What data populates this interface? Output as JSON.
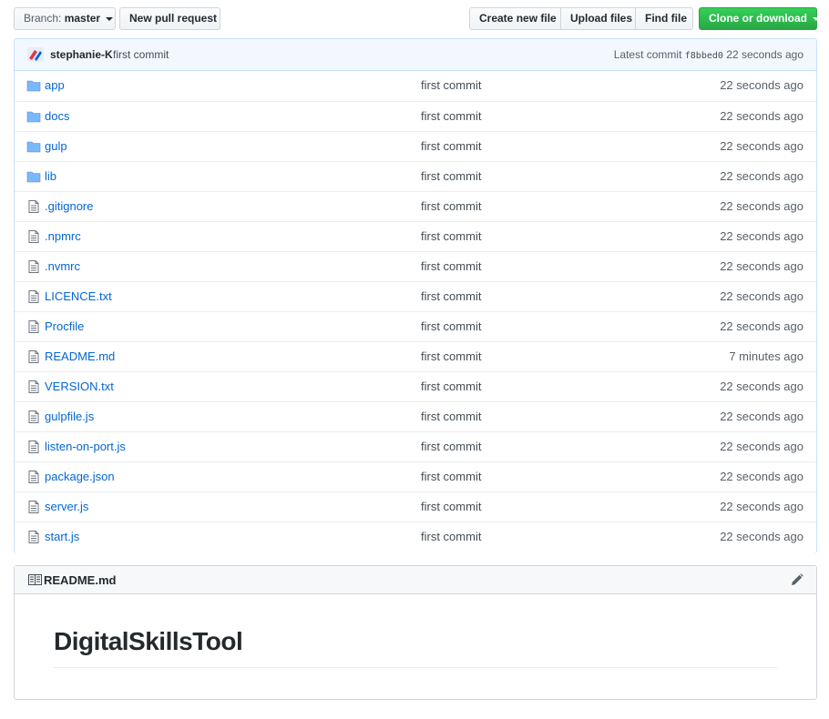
{
  "toolbar": {
    "branch_prefix": "Branch:",
    "branch_name": "master",
    "new_pull_request": "New pull request",
    "create_new_file": "Create new file",
    "upload_files": "Upload files",
    "find_file": "Find file",
    "clone_or_download": "Clone or download"
  },
  "commit": {
    "author": "stephanie-K",
    "message": "first commit",
    "latest_label": "Latest commit",
    "sha": "f8bbed0",
    "age": "22 seconds ago"
  },
  "files": [
    {
      "type": "dir",
      "name": "app",
      "message": "first commit",
      "age": "22 seconds ago"
    },
    {
      "type": "dir",
      "name": "docs",
      "message": "first commit",
      "age": "22 seconds ago"
    },
    {
      "type": "dir",
      "name": "gulp",
      "message": "first commit",
      "age": "22 seconds ago"
    },
    {
      "type": "dir",
      "name": "lib",
      "message": "first commit",
      "age": "22 seconds ago"
    },
    {
      "type": "file",
      "name": ".gitignore",
      "message": "first commit",
      "age": "22 seconds ago"
    },
    {
      "type": "file",
      "name": ".npmrc",
      "message": "first commit",
      "age": "22 seconds ago"
    },
    {
      "type": "file",
      "name": ".nvmrc",
      "message": "first commit",
      "age": "22 seconds ago"
    },
    {
      "type": "file",
      "name": "LICENCE.txt",
      "message": "first commit",
      "age": "22 seconds ago"
    },
    {
      "type": "file",
      "name": "Procfile",
      "message": "first commit",
      "age": "22 seconds ago"
    },
    {
      "type": "file",
      "name": "README.md",
      "message": "first commit",
      "age": "7 minutes ago"
    },
    {
      "type": "file",
      "name": "VERSION.txt",
      "message": "first commit",
      "age": "22 seconds ago"
    },
    {
      "type": "file",
      "name": "gulpfile.js",
      "message": "first commit",
      "age": "22 seconds ago"
    },
    {
      "type": "file",
      "name": "listen-on-port.js",
      "message": "first commit",
      "age": "22 seconds ago"
    },
    {
      "type": "file",
      "name": "package.json",
      "message": "first commit",
      "age": "22 seconds ago"
    },
    {
      "type": "file",
      "name": "server.js",
      "message": "first commit",
      "age": "22 seconds ago"
    },
    {
      "type": "file",
      "name": "start.js",
      "message": "first commit",
      "age": "22 seconds ago"
    }
  ],
  "readme": {
    "filename": "README.md",
    "heading": "DigitalSkillsTool"
  },
  "colors": {
    "link": "#0366d6",
    "clone_button": "#28a745",
    "commit_bar_bg": "#f1f8ff",
    "folder_icon": "#79b8ff"
  },
  "icons": {
    "folder": "folder-icon",
    "file": "file-icon",
    "readme": "book-icon",
    "edit": "pencil-icon"
  }
}
